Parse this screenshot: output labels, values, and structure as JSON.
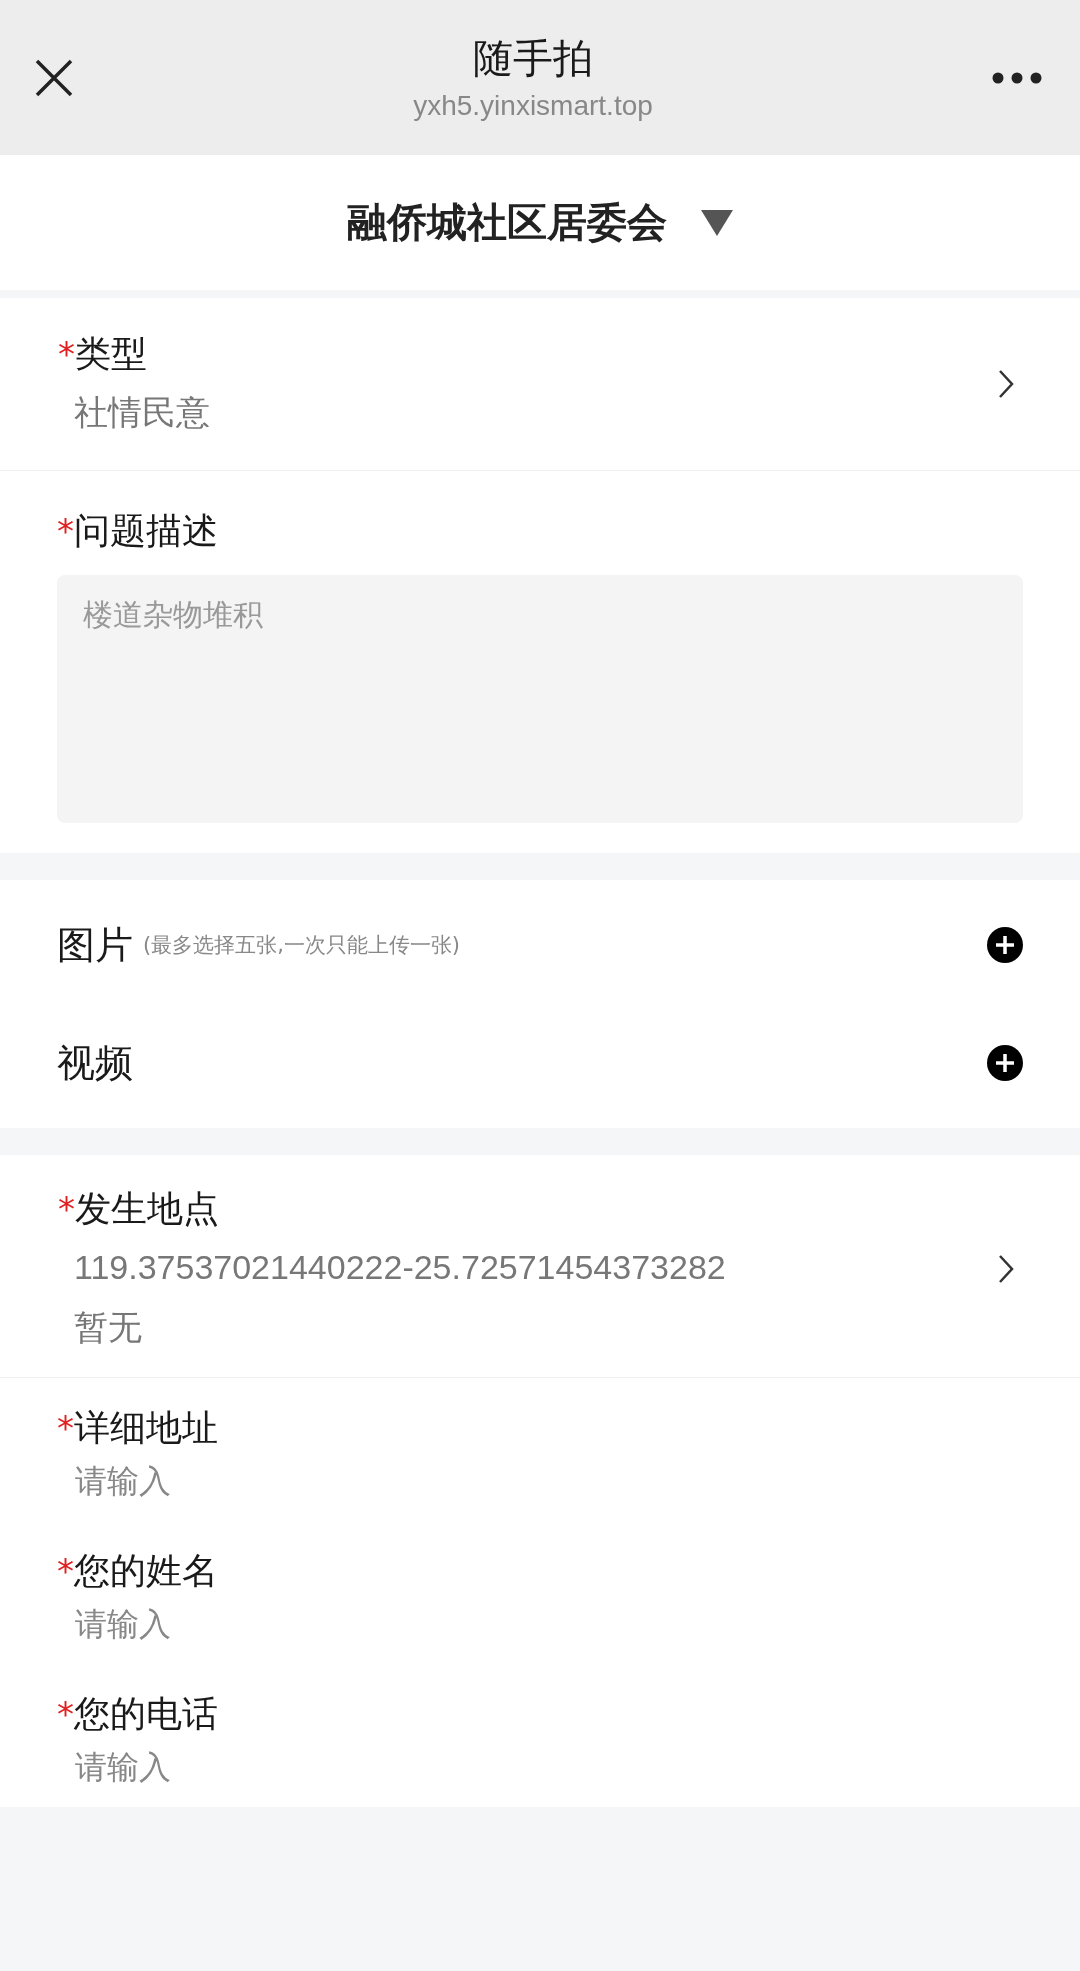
{
  "window": {
    "title": "随手拍",
    "url": "yxh5.yinxismart.top"
  },
  "community": {
    "name": "融侨城社区居委会"
  },
  "type_field": {
    "mark": "*",
    "label": "类型",
    "value": "社情民意"
  },
  "description": {
    "mark": "*",
    "label": "问题描述",
    "placeholder": "楼道杂物堆积"
  },
  "media": [
    {
      "label": "图片",
      "hint": "(最多选择五张,一次只能上传一张)"
    },
    {
      "label": "视频"
    }
  ],
  "location": {
    "mark": "*",
    "label": "发生地点",
    "coordinates": "119.37537021440222-25.72571454373282",
    "address": "暂无"
  },
  "inputs": [
    {
      "mark": "*",
      "label": "详细地址",
      "placeholder": "请输入"
    },
    {
      "mark": "*",
      "label": "您的姓名",
      "placeholder": "请输入"
    },
    {
      "mark": "*",
      "label": "您的电话",
      "placeholder": "请输入"
    }
  ]
}
